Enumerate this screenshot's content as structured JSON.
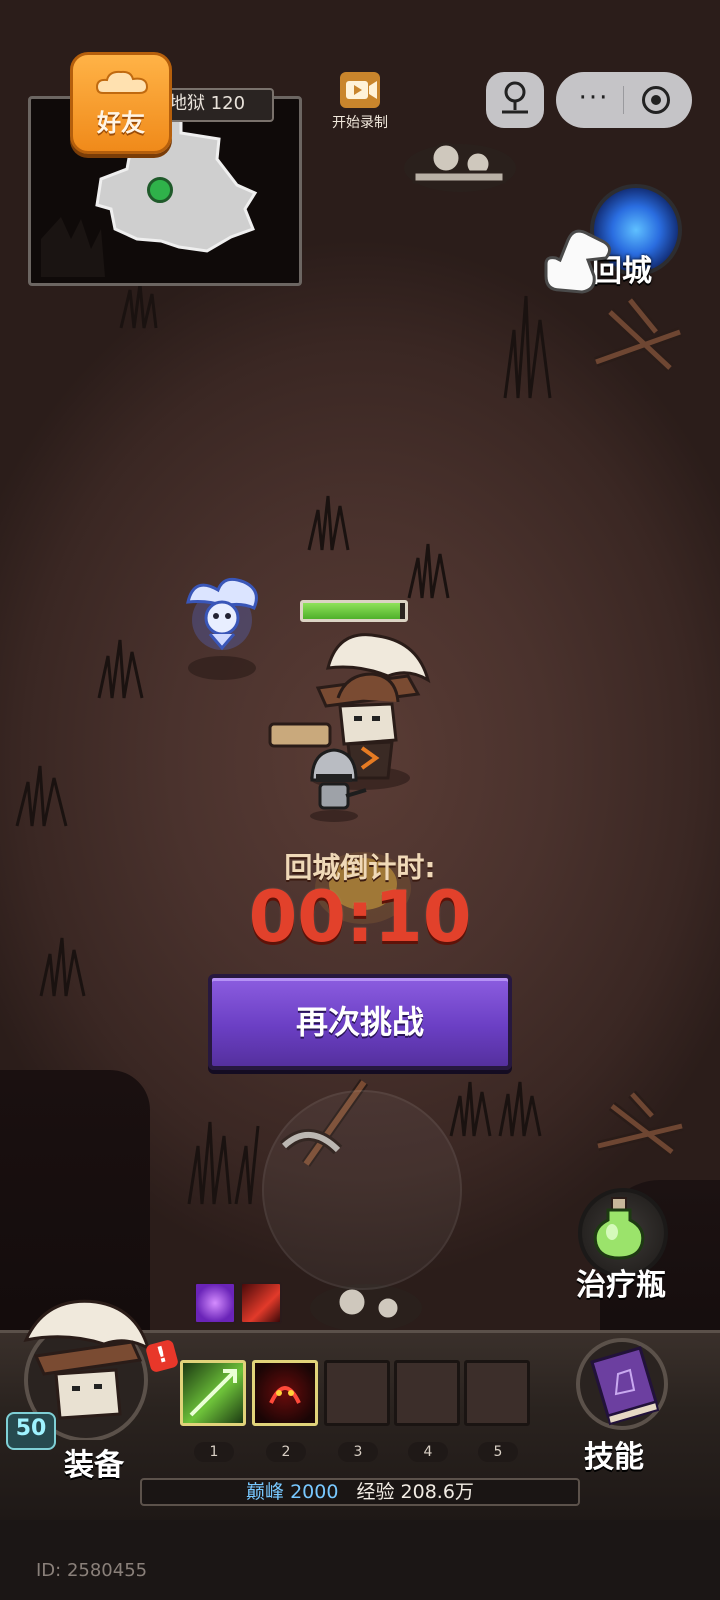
{
  "hud": {
    "friend_button": "好友",
    "map_level": "地狱 120",
    "record_label": "开始录制",
    "return_city_label": "回城",
    "potion_label": "治疗瓶",
    "equip_label": "装备",
    "skills_label": "技能",
    "alert_mark": "!"
  },
  "hero": {
    "level": "50",
    "hp_fraction": 0.95
  },
  "countdown": {
    "label": "回城倒计时:",
    "time": "00:10"
  },
  "retry_button": "再次挑战",
  "skill_slots": [
    {
      "num": "1",
      "filled": true,
      "icon": "green-arrow-skill-icon"
    },
    {
      "num": "2",
      "filled": true,
      "icon": "red-demon-skill-icon"
    },
    {
      "num": "3",
      "filled": false
    },
    {
      "num": "4",
      "filled": false
    },
    {
      "num": "5",
      "filled": false
    }
  ],
  "buffs": [
    "purple-heart-buff-icon",
    "red-slash-buff-icon"
  ],
  "status": {
    "peak": "巅峰 2000",
    "exp": "经验 208.6万"
  },
  "player_id": "ID: 2580455",
  "colors": {
    "countdown_red": "#e2412b",
    "retry_purple": "#6b3fc4",
    "friend_orange": "#f08a1a",
    "hp_green": "#4fb02b",
    "peak_blue": "#78c8ff"
  }
}
